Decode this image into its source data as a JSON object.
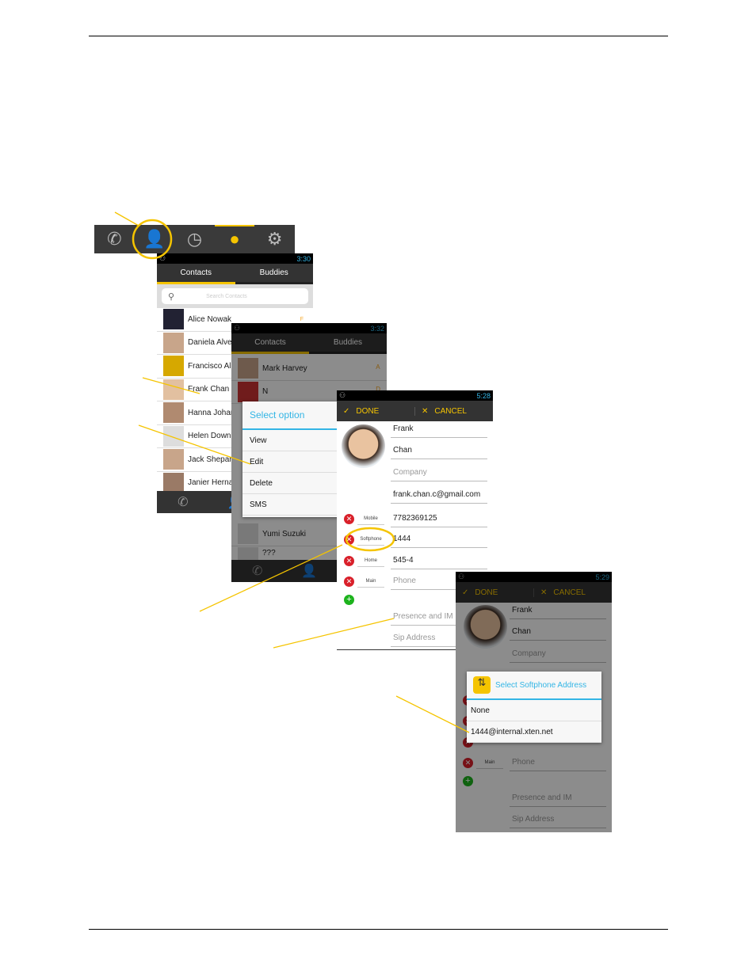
{
  "colors": {
    "accent": "#f5c400",
    "blue": "#33b5e5",
    "dark": "#333333",
    "delete_red": "#d9202a",
    "add_green": "#1db31d"
  },
  "tabbar": {
    "icons": [
      "phone-icon",
      "contacts-icon",
      "history-icon",
      "chat-icon",
      "settings-icon"
    ],
    "selected": "chat-icon"
  },
  "screen1": {
    "time": "3:30",
    "tabs": [
      "Contacts",
      "Buddies"
    ],
    "search_placeholder": "Search Contacts",
    "index_letter": "F",
    "contacts": [
      "Alice Nowak",
      "Daniela Alve",
      "Francisco Al",
      "Frank Chan",
      "Hanna Johar",
      "Helen Down",
      "Jack Shepar",
      "Janier Herna"
    ]
  },
  "screen2": {
    "time": "3:32",
    "tabs": [
      "Contacts",
      "Buddies"
    ],
    "contacts_top": [
      "Mark Harvey",
      "N"
    ],
    "contacts_bottom": [
      "Yumi Suzuki",
      "???"
    ],
    "index_letters": [
      "A",
      "D",
      "F"
    ],
    "dialog": {
      "title": "Select option",
      "options": [
        "View",
        "Edit",
        "Delete",
        "SMS"
      ]
    }
  },
  "screen3": {
    "time": "5:28",
    "done": "DONE",
    "cancel": "CANCEL",
    "fields": {
      "first": "Frank",
      "last": "Chan",
      "company": "Company",
      "email": "frank.chan.c@gmail.com"
    },
    "phones": [
      {
        "label": "Mobile",
        "value": "7782369125"
      },
      {
        "label": "Softphone",
        "value": "1444"
      },
      {
        "label": "Home",
        "value": "545-4"
      },
      {
        "label": "Main",
        "value": "Phone"
      }
    ],
    "presence": "Presence and IM",
    "sip": "Sip Address"
  },
  "screen4": {
    "time": "5:29",
    "done": "DONE",
    "cancel": "CANCEL",
    "fields": {
      "first": "Frank",
      "last": "Chan",
      "company": "Company"
    },
    "main_label": "Main",
    "phone_placeholder": "Phone",
    "presence": "Presence and IM",
    "sip": "Sip Address",
    "dialog": {
      "title": "Select Softphone Address",
      "options": [
        "None",
        "1444@internal.xten.net"
      ]
    }
  }
}
